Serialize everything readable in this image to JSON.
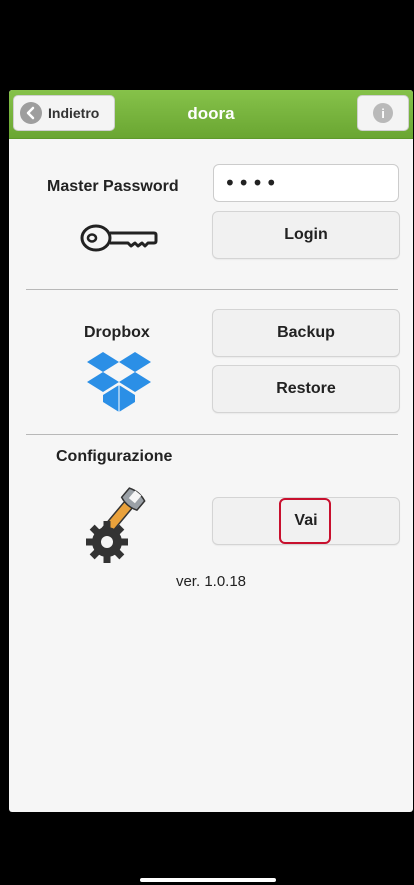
{
  "header": {
    "back_label": "Indietro",
    "title": "doora",
    "info_icon": "info-icon",
    "accent_color": "#78b83d"
  },
  "login": {
    "label": "Master Password",
    "password_value": "••••",
    "button_label": "Login",
    "icon": "key-icon"
  },
  "dropbox": {
    "label": "Dropbox",
    "backup_label": "Backup",
    "restore_label": "Restore",
    "icon": "dropbox-icon",
    "icon_color": "#2b8fe6"
  },
  "config": {
    "label": "Configurazione",
    "button_label": "Vai",
    "icon": "settings-tools-icon",
    "highlight_color": "#c8102e"
  },
  "version": "ver. 1.0.18"
}
